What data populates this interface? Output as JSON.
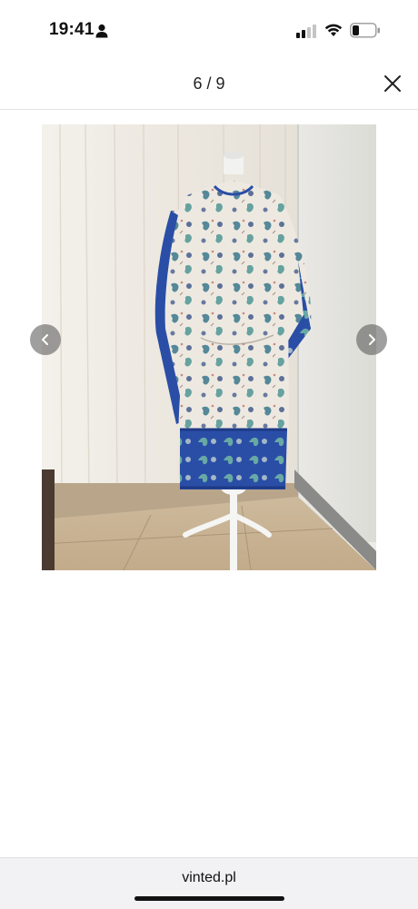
{
  "status_bar": {
    "time": "19:41",
    "icons": [
      "person-icon",
      "cellular-signal-icon",
      "wifi-icon",
      "battery-icon"
    ]
  },
  "header": {
    "page_counter": "6 / 9",
    "close_icon": "close-icon"
  },
  "viewer": {
    "prev_icon": "chevron-left-icon",
    "next_icon": "chevron-right-icon",
    "photo": "paisley-kimono-dress-on-mannequin"
  },
  "browser": {
    "url": "vinted.pl"
  },
  "colors": {
    "accent_blue": "#2a4ea6",
    "nav_button": "#5a5a5a",
    "bar_background": "#f2f2f4"
  }
}
